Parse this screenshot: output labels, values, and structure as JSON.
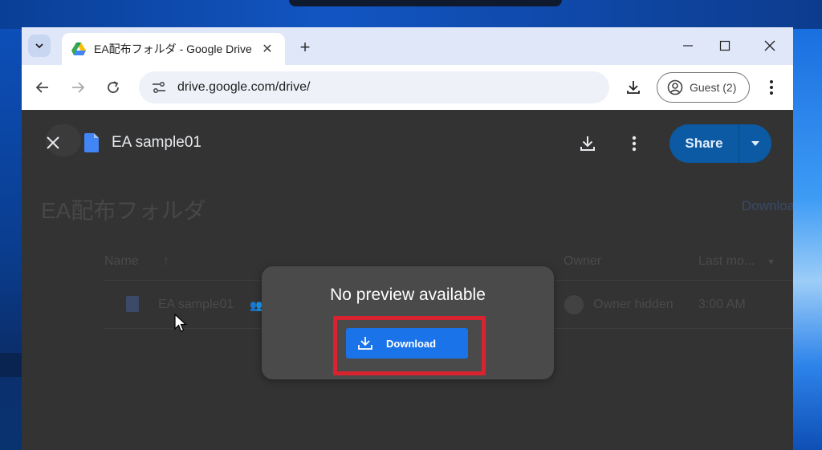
{
  "colors": {
    "chrome_tabstrip": "#dfe7f8",
    "viewer_background": "#333334",
    "share_button": "#0b5aa3",
    "download_button": "#1a73e8",
    "highlight_border": "#d9232f"
  },
  "browser": {
    "tab": {
      "title": "EA配布フォルダ - Google Drive",
      "favicon": "google-drive-icon"
    },
    "address_bar": {
      "url": "drive.google.com/drive/"
    },
    "profile": {
      "label": "Guest (2)"
    }
  },
  "drive_background": {
    "folder_title": "EA配布フォルダ",
    "download_all_link": "Download",
    "columns": {
      "name": "Name",
      "owner": "Owner",
      "last_modified": "Last mo..."
    },
    "row": {
      "file_name": "EA sample01",
      "owner": "Owner hidden",
      "modified": "3:00 AM"
    }
  },
  "viewer": {
    "file_name": "EA sample01",
    "share_label": "Share",
    "no_preview_text": "No preview available",
    "download_button_label": "Download"
  }
}
